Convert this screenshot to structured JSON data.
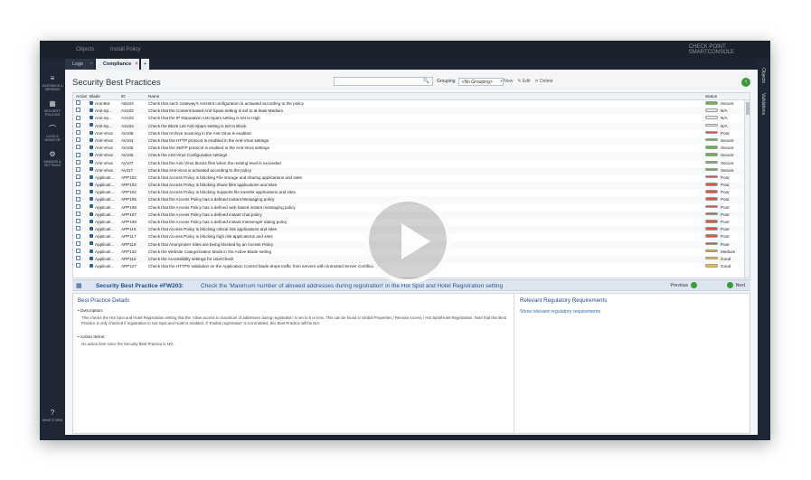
{
  "window": {
    "top_items": [
      "Objects",
      "Install Policy"
    ],
    "brand_lines": [
      "CHECK POINT",
      "SMARTCONSOLE"
    ]
  },
  "tabs": [
    {
      "label": "Logs",
      "close": "×"
    },
    {
      "label": "Compliance",
      "close": "×"
    },
    {
      "label": "+"
    }
  ],
  "sidebar": {
    "items": [
      {
        "icon": "≡",
        "label": "GATEWAYS & SERVERS"
      },
      {
        "icon": "▦",
        "label": "SECURITY POLICIES"
      },
      {
        "icon": "⌒",
        "label": "LOGS & MONITOR"
      },
      {
        "icon": "⚙",
        "label": "MANAGE & SETTINGS"
      },
      {
        "icon": "?",
        "label": "WHAT'S NEW"
      }
    ]
  },
  "right_tabs": [
    "Objects",
    "Validations"
  ],
  "page": {
    "title": "Security Best Practices",
    "search_placeholder": "",
    "search_icon": "🔍",
    "grouping_label": "Grouping",
    "grouping_value": "<No Grouping>",
    "actions": [
      "+ New",
      "✎ Edit",
      "✕ Delete"
    ],
    "nav_icon": "‹"
  },
  "table": {
    "headers": {
      "active": "Active",
      "blade": "Blade",
      "id": "ID",
      "name": "Name",
      "status": "Status"
    },
    "rows": [
      {
        "blade": "Anti-Bot",
        "id": "AB104",
        "name": "Check that each Gateway's Anti-Bot configuration is activated according to the policy",
        "status": "Secure",
        "color": "#67b94a"
      },
      {
        "blade": "Anti-Sp...",
        "id": "AS102",
        "name": "Check that the Content-based Anti-Spam setting is set to at least Medium",
        "status": "N/A",
        "color": "#e9ecef"
      },
      {
        "blade": "Anti-Sp...",
        "id": "AS103",
        "name": "Check that the IP Reputation Anti-Spam setting is set to High",
        "status": "N/A",
        "color": "#e9ecef"
      },
      {
        "blade": "Anti-Sp...",
        "id": "AS104",
        "name": "Check the Block List Anti-Spam setting is set to Block",
        "status": "N/A",
        "color": "#e9ecef"
      },
      {
        "blade": "Anti-Virus",
        "id": "AV108",
        "name": "Check that Archive scanning in the Anti-Virus is enabled",
        "status": "Poor",
        "color": "#e0533d"
      },
      {
        "blade": "Anti-Virus",
        "id": "AV104",
        "name": "Check that the HTTP protocol is enabled in the Anti-Virus settings",
        "status": "Secure",
        "color": "#67b94a"
      },
      {
        "blade": "Anti-Virus",
        "id": "AV105",
        "name": "Check that the SMTP protocol is enabled in the Anti-Virus settings",
        "status": "Secure",
        "color": "#67b94a"
      },
      {
        "blade": "Anti-Virus",
        "id": "AV106",
        "name": "Check the Anti-Virus Configuration settings",
        "status": "Secure",
        "color": "#67b94a"
      },
      {
        "blade": "Anti-Virus",
        "id": "AV107",
        "name": "Check that the Anti-Virus blocks files when the nesting level is exceeded",
        "status": "Secure",
        "color": "#67b94a"
      },
      {
        "blade": "Anti-Virus",
        "id": "AV117",
        "name": "Check that Anti-Virus is activated according to the policy",
        "status": "Secure",
        "color": "#67b94a"
      },
      {
        "blade": "Applicati...",
        "id": "APP102",
        "name": "Check that Access Policy is blocking File storage and sharing applications and sites",
        "status": "Poor",
        "color": "#e0533d"
      },
      {
        "blade": "Applicati...",
        "id": "APP103",
        "name": "Check that Access Policy is blocking Share files applications and sites",
        "status": "Poor",
        "color": "#e0533d"
      },
      {
        "blade": "Applicati...",
        "id": "APP104",
        "name": "Check that Access Policy is blocking Supports file transfer applications and sites",
        "status": "Poor",
        "color": "#e0533d"
      },
      {
        "blade": "Applicati...",
        "id": "APP105",
        "name": "Check that the Access Policy has a defined Instant Messaging policy",
        "status": "Poor",
        "color": "#e0533d"
      },
      {
        "blade": "Applicati...",
        "id": "APP106",
        "name": "Check that the Access Policy has a defined web based instant messaging policy",
        "status": "Poor",
        "color": "#e0533d"
      },
      {
        "blade": "Applicati...",
        "id": "APP107",
        "name": "Check that the Access Policy has a defined instant chat policy",
        "status": "Poor",
        "color": "#e0533d"
      },
      {
        "blade": "Applicati...",
        "id": "APP108",
        "name": "Check that the Access Policy has a defined instant messenger dating policy",
        "status": "Poor",
        "color": "#e0533d"
      },
      {
        "blade": "Applicati...",
        "id": "APP116",
        "name": "Check that Access Policy is blocking critical risk applications and sites",
        "status": "Poor",
        "color": "#e0533d"
      },
      {
        "blade": "Applicati...",
        "id": "APP117",
        "name": "Check that Access Policy is blocking high risk applications and sites",
        "status": "Poor",
        "color": "#e0533d"
      },
      {
        "blade": "Applicati...",
        "id": "APP118",
        "name": "Check that Anonymizer Sites are being blocked by an Access Policy",
        "status": "Poor",
        "color": "#e0533d"
      },
      {
        "blade": "Applicati...",
        "id": "APP132",
        "name": "Check the Website Categorization Mode in the Active Blade setting",
        "status": "Medium",
        "color": "#f0a030"
      },
      {
        "blade": "Applicati...",
        "id": "APP115",
        "name": "Check the Accessibility settings for UserCheck",
        "status": "Good",
        "color": "#f0c030"
      },
      {
        "blade": "Applicati...",
        "id": "APP127",
        "name": "Check that the HTTPS Validation on the Application Control blade drops traffic from servers with Untrusted Server Certificates",
        "status": "Good",
        "color": "#f0c030"
      }
    ]
  },
  "best_practice": {
    "icon": "▦",
    "title": "Security Best Practice #FW203:",
    "subtitle": "Check the 'Maximum number of allowed addresses during registration' in the Hot Spot and Hotel Registration setting",
    "previous": "Previous",
    "next": "Next"
  },
  "details": {
    "heading": "Best Practice Details",
    "description_label": "Description:",
    "description": "This checks the Hot Spot and Hotel Registration setting that the 'Allow access to maximum of addresses during registration' is set to 5 or less. This can be found in Global Properties / Remote Access / Hot Spot/Hotel Registration. Note that this Best Practice is only checked if registration to Hot Spot and Hotel is enabled. If 'Enable registration' is not enabled, this Best Practice will be N/A.",
    "action_label": "Action Items:",
    "action": "No action item since the Security Best Practice is N/A.",
    "reg_heading": "Relevant Regulatory Requirements",
    "reg_link": "Show relevant regulatory requirements"
  }
}
